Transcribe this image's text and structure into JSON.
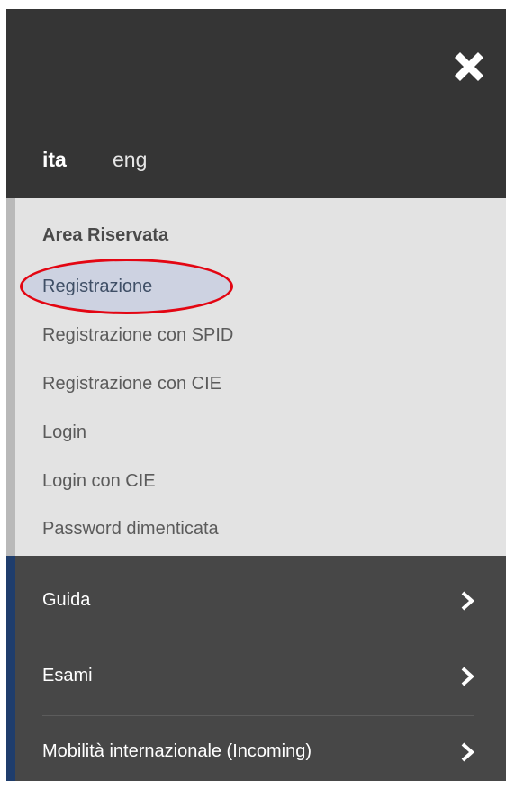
{
  "header": {
    "close_icon": "close-icon",
    "languages": [
      {
        "label": "ita",
        "active": true
      },
      {
        "label": "eng",
        "active": false
      }
    ]
  },
  "area": {
    "title": "Area Riservata",
    "links": [
      {
        "label": "Registrazione",
        "highlighted": true
      },
      {
        "label": "Registrazione con SPID"
      },
      {
        "label": "Registrazione con CIE"
      },
      {
        "label": "Login"
      },
      {
        "label": "Login con CIE"
      },
      {
        "label": "Password dimenticata"
      }
    ]
  },
  "menu": {
    "items": [
      {
        "label": "Guida",
        "icon": "chevron-right-icon"
      },
      {
        "label": "Esami",
        "icon": "chevron-right-icon"
      },
      {
        "label": "Mobilità internazionale (Incoming)",
        "icon": "chevron-right-icon"
      }
    ]
  },
  "colors": {
    "header_bg": "#353535",
    "area_bg": "#e3e3e3",
    "menu_bg": "#474747",
    "accent_blue": "#1f3d6c",
    "highlight_red": "#e30613"
  }
}
